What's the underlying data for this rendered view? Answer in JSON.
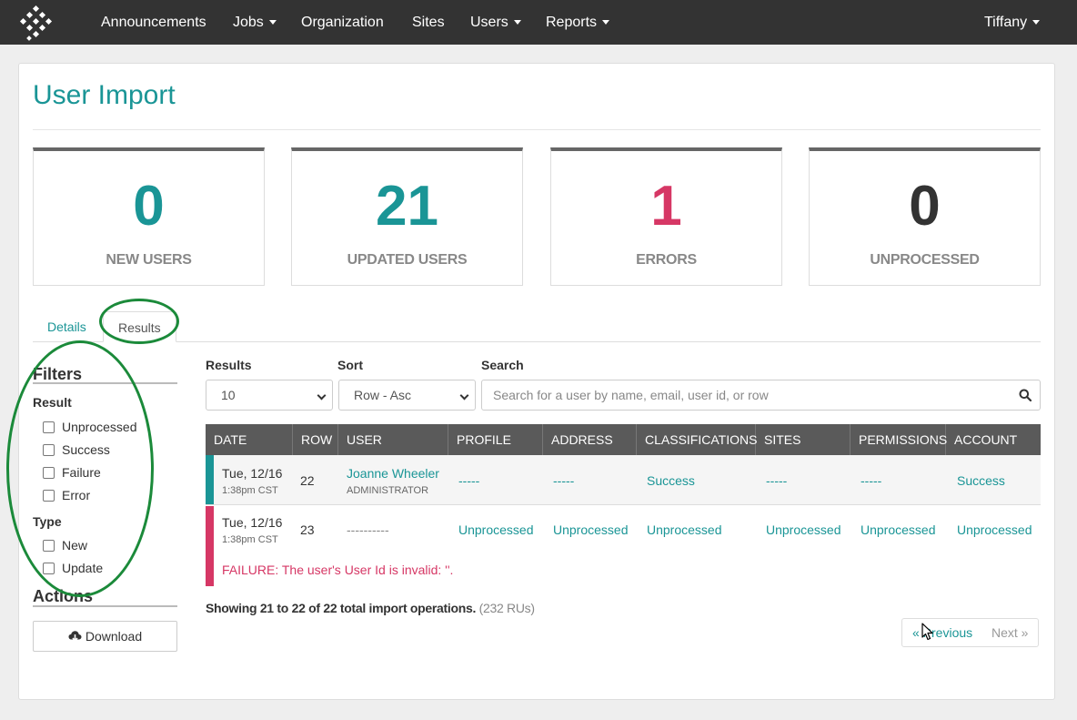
{
  "nav": {
    "items": [
      "Announcements",
      "Jobs",
      "Organization",
      "Sites",
      "Users",
      "Reports"
    ],
    "user": "Tiffany"
  },
  "page": {
    "title": "User Import"
  },
  "stats": [
    {
      "value": "0",
      "label": "NEW USERS",
      "color": "#1a9596"
    },
    {
      "value": "21",
      "label": "UPDATED USERS",
      "color": "#1a9596"
    },
    {
      "value": "1",
      "label": "ERRORS",
      "color": "#d63765"
    },
    {
      "value": "0",
      "label": "UNPROCESSED",
      "color": "#333333"
    }
  ],
  "tabs": {
    "details": "Details",
    "results": "Results"
  },
  "filters": {
    "heading": "Filters",
    "result_label": "Result",
    "result_options": [
      "Unprocessed",
      "Success",
      "Failure",
      "Error"
    ],
    "type_label": "Type",
    "type_options": [
      "New",
      "Update"
    ]
  },
  "actions": {
    "heading": "Actions",
    "download": "Download"
  },
  "controls": {
    "results_label": "Results",
    "results_value": "10",
    "sort_label": "Sort",
    "sort_value": "Row - Asc",
    "search_label": "Search",
    "search_placeholder": "Search for a user by name, email, user id, or row"
  },
  "table": {
    "columns": [
      "DATE",
      "ROW",
      "USER",
      "PROFILE",
      "ADDRESS",
      "CLASSIFICATIONS",
      "SITES",
      "PERMISSIONS",
      "ACCOUNT"
    ],
    "rows": [
      {
        "date": "Tue, 12/16",
        "time": "1:38pm CST",
        "row": "22",
        "user": "Joanne Wheeler",
        "role": "ADMINISTRATOR",
        "profile": "-----",
        "address": "-----",
        "classifications": "Success",
        "sites": "-----",
        "permissions": "-----",
        "account": "Success",
        "status_color": "#1a9596"
      },
      {
        "date": "Tue, 12/16",
        "time": "1:38pm CST",
        "row": "23",
        "user": "----------",
        "profile": "Unprocessed",
        "address": "Unprocessed",
        "classifications": "Unprocessed",
        "sites": "Unprocessed",
        "permissions": "Unprocessed",
        "account": "Unprocessed",
        "error": "FAILURE: The user's User Id is invalid: ''.",
        "status_color": "#d63765"
      }
    ]
  },
  "summary": {
    "text": "Showing 21 to 22 of 22 total import operations.",
    "ru": "(232 RUs)"
  },
  "pagination": {
    "previous": "« Previous",
    "next": "Next »"
  }
}
